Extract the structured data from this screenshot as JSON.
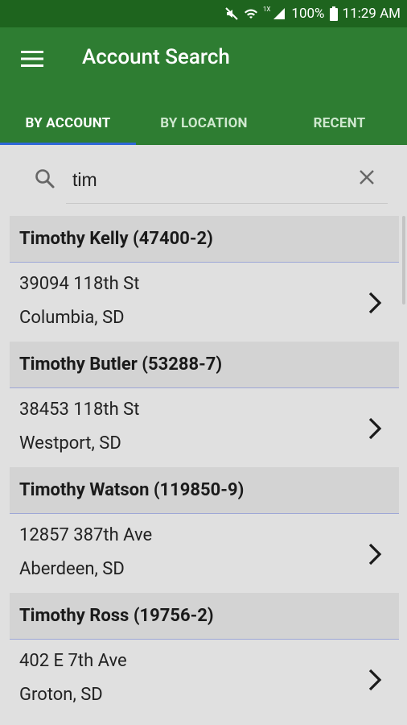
{
  "status": {
    "battery": "100%",
    "time": "11:29 AM",
    "network_label": "1X"
  },
  "app_bar": {
    "title": "Account Search"
  },
  "tabs": [
    {
      "label": "BY ACCOUNT",
      "active": true
    },
    {
      "label": "BY LOCATION",
      "active": false
    },
    {
      "label": "RECENT",
      "active": false
    }
  ],
  "search": {
    "value": "tim",
    "placeholder": ""
  },
  "results": [
    {
      "header": "Timothy Kelly (47400-2)",
      "address_line1": "39094 118th St",
      "address_line2": "Columbia, SD"
    },
    {
      "header": "Timothy Butler (53288-7)",
      "address_line1": "38453 118th St",
      "address_line2": "Westport, SD"
    },
    {
      "header": "Timothy Watson (119850-9)",
      "address_line1": "12857 387th Ave",
      "address_line2": "Aberdeen, SD"
    },
    {
      "header": "Timothy Ross (19756-2)",
      "address_line1": "402 E 7th Ave",
      "address_line2": "Groton, SD"
    }
  ],
  "colors": {
    "app_bar": "#2e7d32",
    "status_bar": "#1e641e",
    "tab_indicator": "#2f68d8",
    "header_bg": "#d3d3d3",
    "body_bg": "#e0e0e0"
  }
}
